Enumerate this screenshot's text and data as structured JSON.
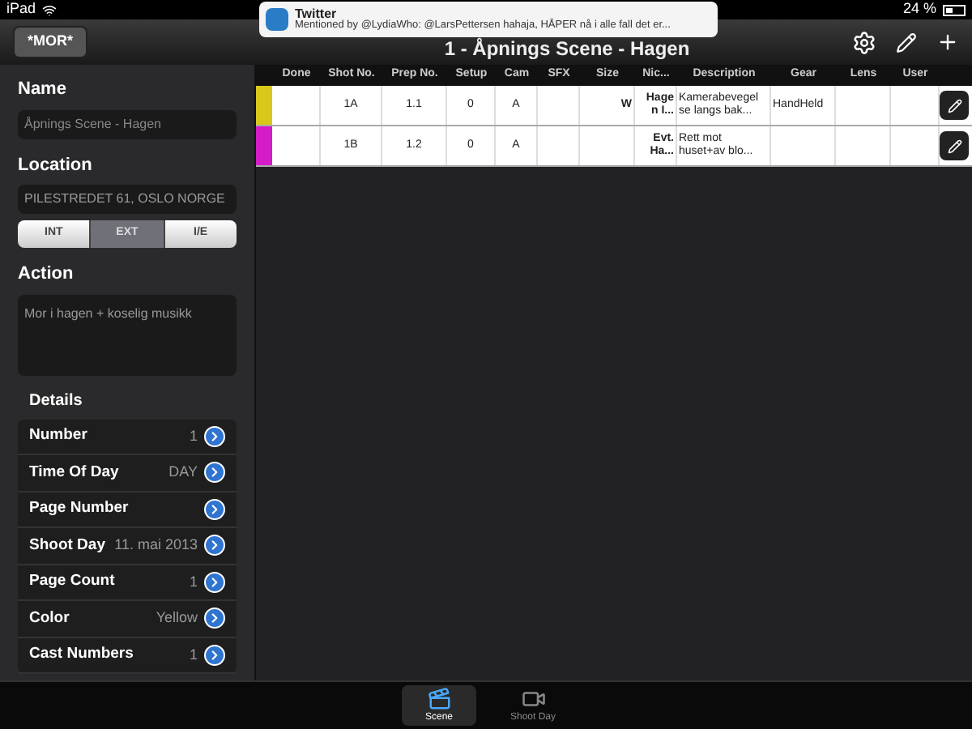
{
  "status_bar": {
    "device": "iPad",
    "battery": "24 %"
  },
  "notification": {
    "app": "Twitter",
    "message": "Mentioned by @LydiaWho: @LarsPettersen hahaja, HÅPER nå i alle fall det er..."
  },
  "nav_bar": {
    "back": "*MOR*",
    "title": "1 - Åpnings Scene - Hagen"
  },
  "form": {
    "name_label": "Name",
    "name_value": "Åpnings Scene - Hagen",
    "location_label": "Location",
    "location_value": "PILESTREDET 61, OSLO NORGE",
    "segments": [
      {
        "label": "INT",
        "selected": false
      },
      {
        "label": "EXT",
        "selected": true
      },
      {
        "label": "I/E",
        "selected": false
      }
    ],
    "action_label": "Action",
    "action_value": "Mor i hagen + koselig musikk",
    "details_label": "Details",
    "details": [
      {
        "label": "Number",
        "value": "1"
      },
      {
        "label": "Time Of Day",
        "value": "DAY"
      },
      {
        "label": "Page Number"
      },
      {
        "label": "Shoot Day",
        "value": "11. mai 2013"
      },
      {
        "label": "Page Count",
        "value": "1"
      },
      {
        "label": "Color",
        "value": "Yellow"
      },
      {
        "label": "Cast Numbers",
        "value": "1"
      }
    ]
  },
  "table": {
    "columns": [
      "Done",
      "Shot No.",
      "Prep No.",
      "Setup",
      "Cam",
      "SFX",
      "Size",
      "Nic...",
      "Description",
      "Gear",
      "Lens",
      "User"
    ],
    "rows": [
      {
        "color": "#d8c81c",
        "cells": [
          "",
          "1A",
          "1.1",
          "0",
          "A",
          "",
          "W",
          "Hage n I...",
          "Kamerabevegel se langs bak...",
          "HandHeld",
          "",
          ""
        ]
      },
      {
        "color": "#d41cc8",
        "cells": [
          "",
          "1B",
          "1.2",
          "0",
          "A",
          "",
          "",
          "Evt. Ha...",
          "Rett mot huset+av blo...",
          "",
          "",
          ""
        ]
      }
    ]
  },
  "tab_bar": [
    {
      "label": "Scene",
      "selected": true
    },
    {
      "label": "Shoot Day",
      "selected": false
    }
  ]
}
